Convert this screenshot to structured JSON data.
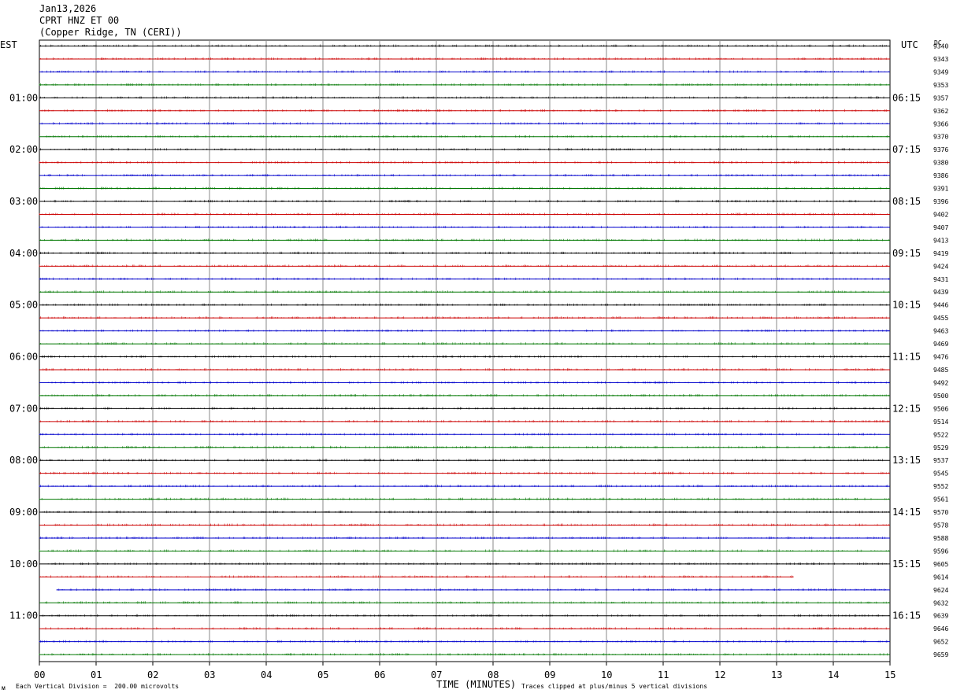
{
  "header": {
    "date": "Jan13,2026",
    "channel": "CPRT HNZ ET 00",
    "station": "(Copper Ridge, TN (CERI))"
  },
  "labels": {
    "left_tz": "EST",
    "right_tz": "UTC",
    "dc": "DC",
    "scale_note": "Each Vertical Division =  200.00 microvolts",
    "clip_note": "Traces clipped at plus/minus 5 vertical divisions",
    "corner_mark": "ᴍ"
  },
  "chart_data": {
    "type": "line",
    "xlabel": "TIME (MINUTES)",
    "xlim": [
      0,
      15
    ],
    "x_ticks": [
      "00",
      "01",
      "02",
      "03",
      "04",
      "05",
      "06",
      "07",
      "08",
      "09",
      "10",
      "11",
      "12",
      "13",
      "14",
      "15"
    ],
    "grid": true,
    "trace_colors": [
      "#000000",
      "#cc0000",
      "#0000cc",
      "#007700"
    ],
    "left_hour_labels": [
      "01:00",
      "02:00",
      "03:00",
      "04:00",
      "05:00",
      "06:00",
      "07:00",
      "08:00",
      "09:00",
      "10:00",
      "11:00"
    ],
    "right_hour_labels": [
      "06:15",
      "07:15",
      "08:15",
      "09:15",
      "10:15",
      "11:15",
      "12:15",
      "13:15",
      "14:15",
      "15:15",
      "16:15"
    ],
    "dc_values": [
      "9340",
      "9343",
      "9349",
      "9353",
      "9357",
      "9362",
      "9366",
      "9370",
      "9376",
      "9380",
      "9386",
      "9391",
      "9396",
      "9402",
      "9407",
      "9413",
      "9419",
      "9424",
      "9431",
      "9439",
      "9446",
      "9455",
      "9463",
      "9469",
      "9476",
      "9485",
      "9492",
      "9500",
      "9506",
      "9514",
      "9522",
      "9529",
      "9537",
      "9545",
      "9552",
      "9561",
      "9570",
      "9578",
      "9588",
      "9596",
      "9605",
      "9614",
      "9624",
      "9632",
      "9639",
      "9646",
      "9652",
      "9659"
    ],
    "partial_traces": [
      {
        "row": 41,
        "end_minute": 13.3
      },
      {
        "row": 42,
        "start_minute": 0.3
      }
    ]
  }
}
